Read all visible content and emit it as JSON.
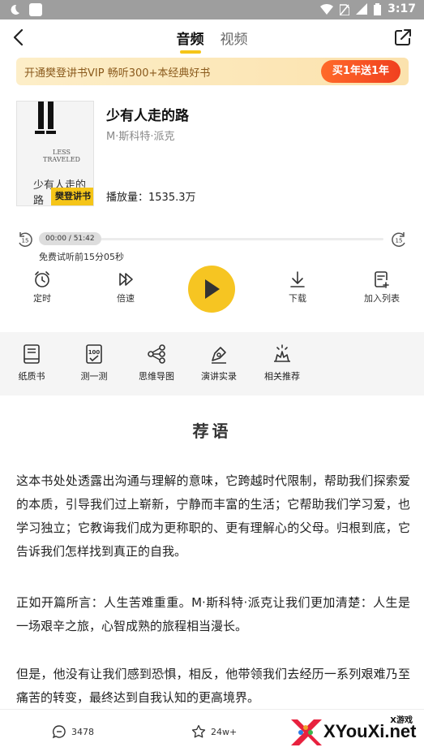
{
  "status_bar": {
    "time": "3:17"
  },
  "nav": {
    "tab_audio": "音频",
    "tab_video": "视频"
  },
  "vip_banner": {
    "text": "开通樊登讲书VIP 畅听300+本经典好书",
    "button": "买1年送1年"
  },
  "book": {
    "title": "少有人走的路",
    "author": "M·斯科特·派克",
    "plays": "播放量：1535.3万",
    "cover_text_en": "LESS TRAVELED",
    "cover_handwriting": "少有人走的路",
    "cover_badge": "樊登讲书"
  },
  "player": {
    "time": "00:00 / 51:42",
    "trial_text": "免费试听前15分05秒",
    "skip_back": "15",
    "skip_forward": "15"
  },
  "controls": [
    {
      "label": "定时",
      "icon": "alarm-clock-icon"
    },
    {
      "label": "倍速",
      "icon": "speed-icon"
    },
    {
      "label": "下载",
      "icon": "download-icon"
    },
    {
      "label": "加入列表",
      "icon": "add-playlist-icon"
    }
  ],
  "features": [
    {
      "label": "纸质书",
      "icon": "paper-book-icon"
    },
    {
      "label": "测一测",
      "icon": "quiz-icon"
    },
    {
      "label": "思维导图",
      "icon": "mind-map-icon"
    },
    {
      "label": "演讲实录",
      "icon": "speech-record-icon"
    },
    {
      "label": "相关推荐",
      "icon": "recommend-icon"
    }
  ],
  "content": {
    "section_title": "荐语",
    "paragraphs": [
      "这本书处处透露出沟通与理解的意味，它跨越时代限制，帮助我们探索爱的本质，引导我们过上崭新，宁静而丰富的生活；它帮助我们学习爱，也学习独立；它教诲我们成为更称职的、更有理解心的父母。归根到底，它告诉我们怎样找到真正的自我。",
      "正如开篇所言：人生苦难重重。M·斯科特·派克让我们更加清楚：人生是一场艰辛之旅，心智成熟的旅程相当漫长。",
      "但是，他没有让我们感到恐惧，相反，他带领我们去经历一系列艰难乃至痛苦的转变，最终达到自我认知的更高境界。"
    ]
  },
  "bottom_bar": {
    "comments": "3478",
    "favorites": "24w+"
  },
  "watermark": {
    "text": "XYouXi.net",
    "small": "X游戏"
  },
  "colors": {
    "accent": "#f5c518",
    "vip_button": "#f0401f",
    "feature_bg": "#f5f5f5"
  }
}
